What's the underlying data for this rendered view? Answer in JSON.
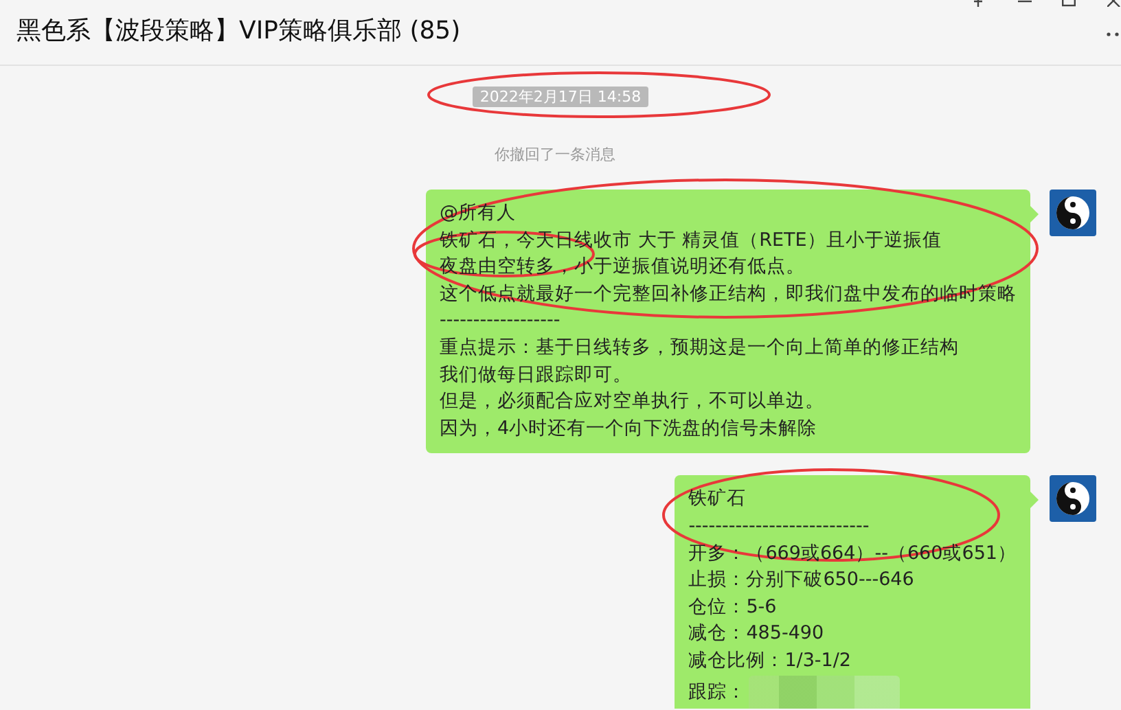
{
  "window": {
    "title": "黑色系【波段策略】VIP策略俱乐部  (85)"
  },
  "timestamp": "2022年2月17日 14:58",
  "system_notice": "你撤回了一条消息",
  "messages": [
    {
      "lines": [
        "@所有人",
        "铁矿石，今天日线收市 大于 精灵值（RETE）且小于逆振值",
        "夜盘由空转多，小于逆振值说明还有低点。",
        "这个低点就最好一个完整回补修正结构，即我们盘中发布的临时策略",
        "------------------",
        "重点提示：基于日线转多，预期这是一个向上简单的修正结构",
        "我们做每日跟踪即可。",
        "但是，必须配合应对空单执行，不可以单边。",
        "因为，4小时还有一个向下洗盘的信号未解除"
      ]
    },
    {
      "lines": [
        "铁矿石",
        "---------------------------",
        "开多：（669或664）--（660或651）",
        "止损：分别下破650---646",
        "仓位：5-6",
        "减仓：485-490",
        "减仓比例：1/3-1/2",
        "跟踪："
      ],
      "redacted_last_line": true
    }
  ]
}
